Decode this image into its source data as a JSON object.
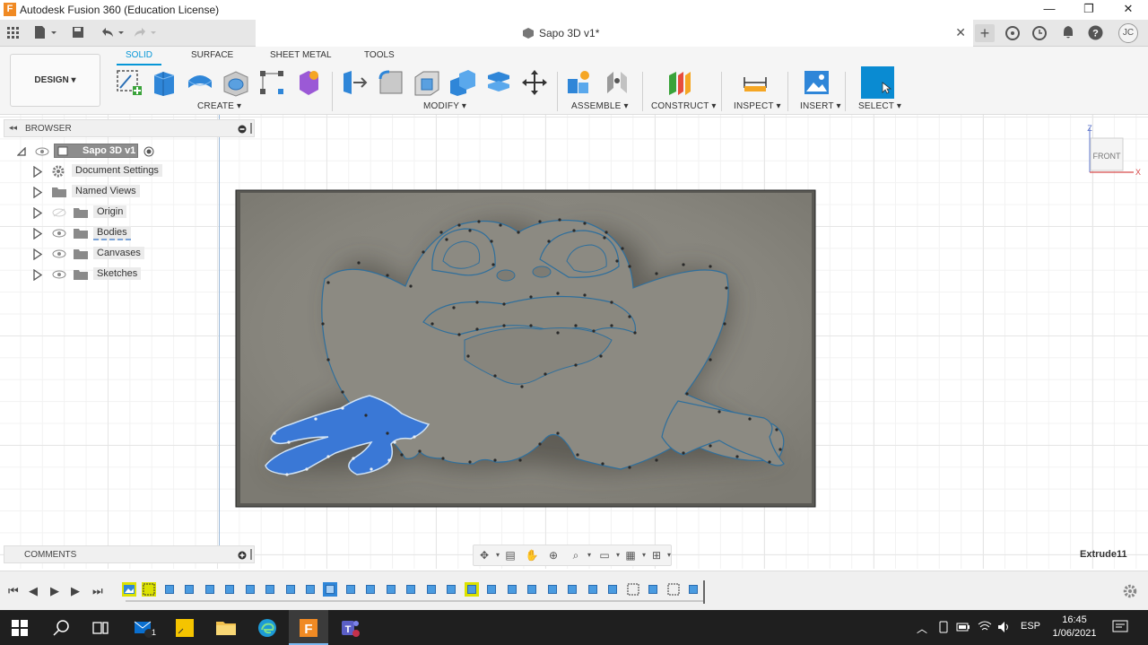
{
  "window": {
    "title": "Autodesk Fusion 360 (Education License)",
    "app_letter": "F",
    "min": "—",
    "restore": "❐",
    "close": "✕"
  },
  "tabbar": {
    "doc_title": "Sapo 3D v1*",
    "close": "✕",
    "add": "+",
    "avatar": "JC"
  },
  "toolbar": {
    "workspace": "DESIGN ▾",
    "tabs": [
      "SOLID",
      "SURFACE",
      "SHEET METAL",
      "TOOLS"
    ],
    "groups": [
      "CREATE ▾",
      "MODIFY ▾",
      "ASSEMBLE ▾",
      "CONSTRUCT ▾",
      "INSPECT ▾",
      "INSERT ▾",
      "SELECT ▾"
    ]
  },
  "browser": {
    "title": "BROWSER",
    "root": "Sapo 3D v1",
    "items": [
      "Document Settings",
      "Named Views",
      "Origin",
      "Bodies",
      "Canvases",
      "Sketches"
    ]
  },
  "comments": {
    "title": "COMMENTS"
  },
  "viewcube": {
    "face": "FRONT",
    "z": "Z",
    "x": "X"
  },
  "status": {
    "feature": "Extrude11"
  },
  "taskbar": {
    "lang": "ESP",
    "time": "16:45",
    "date": "1/06/2021",
    "mail_badge": "1"
  },
  "colors": {
    "accent": "#0696d7",
    "selected_body": "#3a78d6",
    "plate": "#86847c",
    "highlight": "#dce200"
  }
}
